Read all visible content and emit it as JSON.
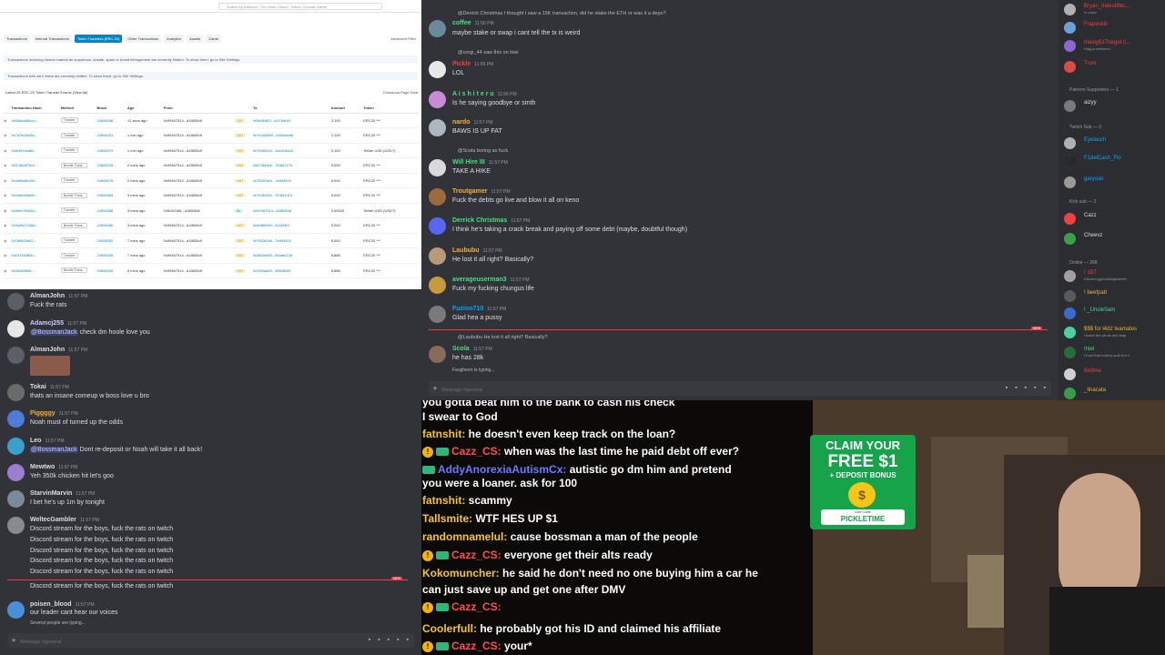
{
  "etherscan": {
    "search_placeholder": "Search by Address / Txn Hash / Block / Token / Domain Name",
    "tabs": [
      "Transactions",
      "Internal Transactions",
      "Token Transfers (ERC-20)",
      "Other Transactions",
      "Analytics",
      "Assets",
      "Cards"
    ],
    "advanced_filter": "Advanced Filter",
    "banner1": "Transactions involving tokens marked as suspicious, unsafe, spam or brand infringement are currently hidden. To show them, go to Site Settings.",
    "banner2": "Transactions with zero Value are currently hidden. To show them, go to Site Settings.",
    "latest": "Latest 25 ERC-20 Token Transfer Events (View All)",
    "download": "Download Page Data",
    "headers": [
      "",
      "Transaction Hash",
      "Method",
      "Block",
      "Age",
      "From",
      "",
      "To",
      "Amount",
      "Token"
    ],
    "rows": [
      [
        "0x05ada80bcd...",
        "Transfer",
        "24908436",
        "12 secs ago",
        "0x99467514...d18830df",
        "OUT",
        "0x9e5f4f63...d1f7d4b4f",
        "2,100",
        "ERC20 ***"
      ],
      [
        "0x7d7bc8e2fa...",
        "Transfer",
        "24908431",
        "1 min ago",
        "0x99467514...d18830df",
        "OUT",
        "0x7e2d4f5f0...d33e9a4f6",
        "2,100",
        "ERC20 ***"
      ],
      [
        "0x6c9f16ea80...",
        "Transfer",
        "24908379",
        "1 min ago",
        "0x99467514...d18830df",
        "OUT",
        "0x7e5f3e1b...1a4116d43",
        "2,100",
        "Tether USD (USDT)"
      ],
      [
        "0x07d5d576c2...",
        "Bundle Trans...",
        "24908378",
        "2 mins ago",
        "0x99467514...d18830df",
        "OUT",
        "0x87f3d2b6...7f28d7174",
        "5,000",
        "ERC20 ***"
      ],
      [
        "0x4df9a8b155...",
        "Transfer",
        "24908376",
        "2 mins ago",
        "0x99467514...d18830df",
        "OUT",
        "0x7f5329a4...7a9d3f11f",
        "5,000",
        "ERC20 ***"
      ],
      [
        "0x04d6d0a6f6...",
        "Bundle Trans...",
        "24908365",
        "3 mins ago",
        "0x99467514...d18830df",
        "OUT",
        "0x7e5f3d2b...7f28d7d14",
        "5,000",
        "ERC20 ***"
      ],
      [
        "0x9ee03f1b5d...",
        "Transfer",
        "24908358",
        "3 mins ago",
        "0xfb3d7af6...d18830df",
        "IN",
        "0x99467514...d18830df",
        "0.00025",
        "Tether USD (USDT)"
      ],
      [
        "0x3ce5d7198a...",
        "Bundle Trans...",
        "24908356",
        "3 mins ago",
        "0x99467514...d18830df",
        "OUT",
        "0xe6f89040...52d2f4f3",
        "5,000",
        "ERC20 ***"
      ],
      [
        "0x7b5693d42...",
        "Transfer",
        "24908352",
        "7 mins ago",
        "0x99467514...d18830df",
        "OUT",
        "0x7f52b2d6...7a9d3f11f",
        "5,000",
        "ERC20 ***"
      ],
      [
        "0x13748380b...",
        "Transfer",
        "24908349",
        "7 mins ago",
        "0x99467514...d18830df",
        "OUT",
        "0x3f63d905...5d4ab174f",
        "8,888",
        "ERC20 ***"
      ],
      [
        "0x0846f8f96...",
        "Bundle Trans...",
        "24908345",
        "8 mins ago",
        "0x99467514...d18830df",
        "OUT",
        "0x7f50aa09...4ff6350bf",
        "8,888",
        "ERC20 ***"
      ]
    ]
  },
  "discord_left": {
    "messages": [
      {
        "user": "AlmanJohn",
        "time": "11:57 PM",
        "text": "Fuck the rats",
        "color": "#dbdee1",
        "avatar": "#5b5f66"
      },
      {
        "user": "Adamcj255",
        "time": "11:57 PM",
        "mention": "@BossmanJack",
        "text": " check dm hoole love you",
        "color": "#c9cdfb",
        "avatar": "#e7e7e7"
      },
      {
        "user": "AlmanJohn",
        "time": "11:57 PM",
        "text": "",
        "color": "#dbdee1",
        "avatar": "#5b5f66"
      },
      {
        "user": "Tokai",
        "time": "11:57 PM",
        "text": "thats an insane comeup w boss love u bro",
        "color": "#dbdee1",
        "avatar": "#6b6b6b"
      },
      {
        "user": "Piggggy",
        "time": "11:57 PM",
        "text": "Noah must of turned up the odds",
        "color": "#f0b232",
        "avatar": "#4f7bd9"
      },
      {
        "user": "Leo",
        "time": "11:57 PM",
        "mention": "@BossmanJack",
        "text": " Dont re-deposit or Noah will take it all back!",
        "color": "#dbdee1",
        "avatar": "#3aa0c9"
      },
      {
        "user": "Mewtwo",
        "time": "11:57 PM",
        "text": "Yeh 350k chicken hit let's goo",
        "color": "#dbdee1",
        "avatar": "#9a7fd1"
      },
      {
        "user": "StarvinMarvin",
        "time": "11:57 PM",
        "text": "I bet he's up 1m by tonight",
        "color": "#dbdee1",
        "avatar": "#7a8a9a"
      },
      {
        "user": "WeltecGambler",
        "time": "11:57 PM",
        "text": "Discord stream for the boys, fuck the rats on twitch",
        "color": "#dbdee1",
        "avatar": "#8a8a8a"
      }
    ],
    "repeat_lines": [
      "Discord stream for the boys, fuck the rats on twitch",
      "Discord stream for the boys, fuck the rats on twitch",
      "Discord stream for the boys, fuck the rats on twitch",
      "Discord stream for the boys, fuck the rats on twitch"
    ],
    "after_new": "Discord stream for the boys, fuck the rats on twitch",
    "last": {
      "user": "poisen_blood",
      "time": "11:57 PM",
      "text": "our leader cant hear our voices",
      "avatar": "#4a8fd9"
    },
    "typing": "Several people are typing...",
    "input_placeholder": "Message #general",
    "new_tag": "NEW"
  },
  "discord_main": {
    "top_line": "@Derrick Christmas I thought I saw a 15K transaction, did he stake the ETH or was it a depo?",
    "top_user": "coffee",
    "top_time": "11:56 PM",
    "top_text": "maybe stake or swap i cant tell the tx is weird",
    "messages": [
      {
        "reply": "@corgi_44 saw this on kiwi",
        "user": "Pickle",
        "time": "11:56 PM",
        "text": "LOL",
        "color": "#f23f43",
        "avatar": "#e8e8e8"
      },
      {
        "reply": "",
        "user": "A i s h i t e r u",
        "time": "11:56 PM",
        "text": "Is he saying goodbye or smth",
        "color": "#4ade80",
        "avatar": "#c98ad6"
      },
      {
        "reply": "",
        "user": "nardo",
        "time": "11:57 PM",
        "text": "BAWS IS UP FAT",
        "color": "#f0b232",
        "avatar": "#b0b6bd"
      },
      {
        "reply": "@Scola boring as fuck",
        "user": "Will Hire III",
        "time": "11:57 PM",
        "text": "TAKE A HIKE",
        "color": "#4ade80",
        "avatar": "#d9d9d9"
      },
      {
        "reply": "",
        "user": "Troutgamer",
        "time": "11:57 PM",
        "text": "Fuck the debts go live and blow it all on keno",
        "color": "#f0b232",
        "avatar": "#9c6b3d"
      },
      {
        "reply": "",
        "user": "Derrick Christmas",
        "time": "11:57 PM",
        "text": "I think he's taking a crack break and paying off some debt (maybe, doubtful though)",
        "color": "#4ade80",
        "avatar": "#5865f2"
      },
      {
        "reply": "",
        "user": "Laububu",
        "time": "11:57 PM",
        "text": "He lost it all right? Basically?",
        "color": "#f0b232",
        "avatar": "#b89a7a"
      },
      {
        "reply": "",
        "user": "averageuserman3",
        "time": "11:57 PM",
        "text": "Fuck my fucking chungus life",
        "color": "#4ade80",
        "avatar": "#c99a3d"
      },
      {
        "reply": "",
        "user": "Fuzion710",
        "time": "11:57 PM",
        "text": "Glad hea a pussy",
        "color": "#00a8fc",
        "avatar": "#7a7a7a"
      },
      {
        "reply": "@Laububu He lost it all right? Basically?",
        "user": "Scola",
        "time": "11:57 PM",
        "text": "he has 28k",
        "color": "#4ade80",
        "avatar": "#8a6a5a"
      }
    ],
    "typing": "Faugheen is typing...",
    "input_placeholder": "Message #general",
    "new_tag": "NEW"
  },
  "members": {
    "items": [
      {
        "type": "member",
        "name": "Bryan_Indestifter...",
        "sub": "In voice",
        "color": "#f23f43",
        "avatar": "#b0b0b0"
      },
      {
        "type": "member",
        "name": "Frapeskill",
        "sub": "",
        "color": "#f23f43",
        "avatar": "#6aa0d8"
      },
      {
        "type": "member",
        "name": "maxig617target (i...",
        "sub": "Happy weekend",
        "color": "#f23f43",
        "avatar": "#8a6ad0"
      },
      {
        "type": "member",
        "name": "Troni",
        "sub": "",
        "color": "#f23f43",
        "avatar": "#d94a4a"
      },
      {
        "type": "header",
        "name": "Patreon Supporters — 1"
      },
      {
        "type": "member",
        "name": "aizyy",
        "sub": "",
        "color": "#dbdee1",
        "avatar": "#7a7a7a"
      },
      {
        "type": "header",
        "name": "Twitch Sub — 3"
      },
      {
        "type": "member",
        "name": "Eyelasch",
        "sub": "",
        "color": "#00a8fc",
        "avatar": "#b0b0b0"
      },
      {
        "type": "member",
        "name": "F1delCash_Flo",
        "sub": "",
        "color": "#00a8fc",
        "avatar": "#2a2a2a"
      },
      {
        "type": "member",
        "name": "garyoak",
        "sub": "",
        "color": "#00a8fc",
        "avatar": "#9a9a9a"
      },
      {
        "type": "header",
        "name": "Kick sub — 2"
      },
      {
        "type": "member",
        "name": "Cazz",
        "sub": "",
        "color": "#dbdee1",
        "avatar": "#f23f43"
      },
      {
        "type": "member",
        "name": "Cheevz",
        "sub": "",
        "color": "#dbdee1",
        "avatar": "#3aa04a"
      },
      {
        "type": "header",
        "name": "Online — 268"
      },
      {
        "type": "member",
        "name": "! 187",
        "sub": "Discord.gg/buildingbulletin",
        "color": "#f23f43",
        "avatar": "#a0a0a0"
      },
      {
        "type": "member",
        "name": "! beefpatt",
        "sub": "",
        "color": "#f0b232",
        "avatar": "#5a5a5a"
      },
      {
        "type": "member",
        "name": "! _UncleSam",
        "sub": "",
        "color": "#4ade80",
        "avatar": "#3a6ad0"
      },
      {
        "type": "member",
        "name": "$$$ for l4d2 teamates",
        "sub": "i travel the winds and leap",
        "color": "#f0b232",
        "avatar": "#4ad0a0"
      },
      {
        "type": "member",
        "name": "!ntel",
        "sub": "I'll put that lowkey sold but it",
        "color": "#4ade80",
        "avatar": "#2a6a3a"
      },
      {
        "type": "member",
        "name": "6ix9ine",
        "sub": "",
        "color": "#f23f43",
        "avatar": "#d0d0d0"
      },
      {
        "type": "member",
        "name": "_linacata",
        "sub": "",
        "color": "#f0b232",
        "avatar": "#3a9a4a"
      }
    ]
  },
  "stream_chat": {
    "lines": [
      {
        "parts": [
          {
            "t": "I swear to God",
            "c": "#ffffff"
          }
        ]
      },
      {
        "parts": [
          {
            "t": "fatnshit:",
            "c": "#f5c518"
          },
          {
            "t": " he doesn't even keep track on the loan?",
            "c": "#ffffff"
          }
        ]
      },
      {
        "badge": true,
        "parts": [
          {
            "t": "Cazz_CS:",
            "c": "#ff4d4d"
          },
          {
            "t": " when was the last time he paid debt off ever?",
            "c": "#ffffff"
          }
        ]
      },
      {
        "mini": true,
        "parts": [
          {
            "t": "AddyAnorexiaAutismCx:",
            "c": "#6b7bff"
          },
          {
            "t": " autistic go dm him and pretend",
            "c": "#ffffff"
          }
        ]
      },
      {
        "parts": [
          {
            "t": "you were a loaner. ask for 100",
            "c": "#ffffff"
          }
        ]
      },
      {
        "parts": [
          {
            "t": "fatnshit:",
            "c": "#f5c518"
          },
          {
            "t": " scammy",
            "c": "#ffffff"
          }
        ]
      },
      {
        "parts": [
          {
            "t": "Tallsmite:",
            "c": "#f5c518"
          },
          {
            "t": " WTF HES UP $1",
            "c": "#ffffff"
          }
        ]
      },
      {
        "parts": [
          {
            "t": "randomnamelul:",
            "c": "#f5c518"
          },
          {
            "t": " cause bossman a man of the people",
            "c": "#ffffff"
          }
        ]
      },
      {
        "badge": true,
        "parts": [
          {
            "t": "Cazz_CS:",
            "c": "#ff4d4d"
          },
          {
            "t": " everyone get their alts ready",
            "c": "#ffffff"
          }
        ]
      },
      {
        "parts": [
          {
            "t": "Kokomuncher:",
            "c": "#f5c518"
          },
          {
            "t": " he said he don't need no one buying him a car he",
            "c": "#ffffff"
          }
        ]
      },
      {
        "parts": [
          {
            "t": "can just save up and get one after DMV",
            "c": "#ffffff"
          }
        ]
      },
      {
        "badge": true,
        "parts": [
          {
            "t": "Cazz_CS:",
            "c": "#ff4d4d"
          },
          {
            "t": "",
            "c": "#ffffff"
          }
        ]
      },
      {
        "parts": [
          {
            "t": "Coolerfull:",
            "c": "#f5c518"
          },
          {
            "t": " he probably got his ID and claimed his affiliate",
            "c": "#ffffff"
          }
        ]
      },
      {
        "badge": true,
        "parts": [
          {
            "t": "Cazz_CS:",
            "c": "#ff4d4d"
          },
          {
            "t": " your*",
            "c": "#ffffff"
          }
        ]
      }
    ],
    "top_partial": "you gotta beat him to the bank to cash his check"
  },
  "ad": {
    "line1": "CLAIM YOUR",
    "line2": "FREE $1",
    "line3": "+ DEPOSIT BONUS",
    "code_label": "Use Code",
    "code": "PICKLETIME",
    "coin": "$"
  }
}
